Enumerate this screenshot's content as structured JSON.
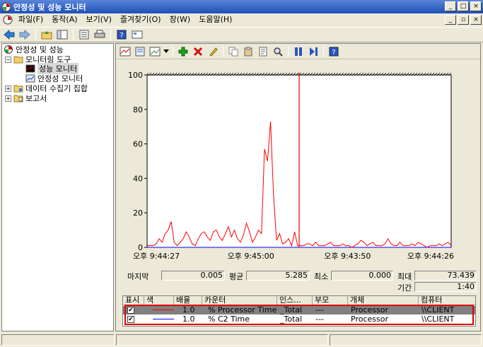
{
  "window": {
    "title": "안정성 및 성능 모니터",
    "btn_min": "_",
    "btn_max": "□",
    "btn_close": "×"
  },
  "menu": {
    "items": [
      "파일(F)",
      "동작(A)",
      "보기(V)",
      "즐겨찾기(O)",
      "창(W)",
      "도움말(H)"
    ],
    "child_min": "_",
    "child_restore": "▫",
    "child_close": "×"
  },
  "tree": {
    "root": "안정성 및 성능",
    "monitoring_tools": "모니터링 도구",
    "performance_monitor": "성능 모니터",
    "reliability_monitor": "안정성 모니터",
    "data_collector_sets": "데이터 수집기 집합",
    "reports": "보고서",
    "expand": "+",
    "collapse": "−"
  },
  "chart_data": {
    "type": "line",
    "ylim": [
      0,
      100
    ],
    "yticks": [
      0,
      20,
      40,
      60,
      80,
      100
    ],
    "xtick_labels": [
      "오후 9:44:27",
      "오후 9:45:00",
      "오후 9:43:50",
      "오후 9:44:26"
    ],
    "current_position": 0.5,
    "series": [
      {
        "name": "% Processor Time",
        "color": "#ff0000",
        "values": [
          1,
          1,
          1,
          2,
          5,
          3,
          8,
          10,
          15,
          3,
          1,
          3,
          5,
          9,
          6,
          2,
          1,
          5,
          8,
          9,
          6,
          4,
          9,
          10,
          6,
          4,
          8,
          12,
          6,
          10,
          5,
          3,
          7,
          14,
          9,
          3,
          6,
          10,
          8,
          57,
          50,
          73,
          30,
          4,
          8,
          2,
          3,
          5,
          1,
          9,
          1,
          1,
          1,
          2,
          2,
          1,
          3,
          1,
          1,
          1,
          2,
          3,
          1,
          1,
          1,
          2,
          1,
          1,
          0,
          1,
          2,
          4,
          3,
          1,
          2,
          3,
          1,
          1,
          1,
          2,
          5,
          2,
          1,
          1,
          3,
          1,
          1,
          1,
          2,
          1,
          3,
          2,
          1,
          0,
          1,
          1,
          1,
          2,
          1,
          2,
          3,
          1
        ]
      },
      {
        "name": "% C2 Time",
        "color": "#0000ff",
        "values": [
          0,
          0,
          0,
          0,
          0,
          0,
          0,
          0,
          0,
          0,
          0,
          0,
          0,
          0,
          0,
          0,
          0,
          0,
          0,
          0,
          0,
          0,
          0,
          0,
          0,
          0,
          0,
          0,
          0,
          0,
          0,
          0,
          0,
          0,
          0,
          0,
          0,
          0,
          0,
          0,
          0,
          0,
          0,
          0,
          0,
          0,
          0,
          0,
          0,
          0,
          0,
          0,
          0,
          0,
          0,
          0,
          0,
          0,
          0,
          0,
          0,
          0,
          0,
          0,
          0,
          0,
          0,
          0,
          0,
          0,
          0,
          0,
          0,
          0,
          0,
          0,
          0,
          0,
          0,
          0,
          0,
          0,
          0,
          0,
          0,
          0,
          0,
          0,
          0,
          0,
          0,
          0,
          0,
          0,
          0,
          0,
          0,
          0,
          0,
          0
        ]
      }
    ]
  },
  "stats": {
    "last_label": "마지막",
    "last": "0.005",
    "avg_label": "평균",
    "avg": "5.285",
    "min_label": "최소",
    "min": "0.000",
    "max_label": "최대",
    "max": "73.439",
    "duration_label": "기간",
    "duration": "1:40"
  },
  "counters": {
    "headers": [
      "표시",
      "색",
      "배율",
      "카운터",
      "인스...",
      "부모",
      "개체",
      "컴퓨터"
    ],
    "rows": [
      {
        "show": "✔",
        "color": "#ff0000",
        "scale": "1.0",
        "counter": "% Processor Time",
        "instance": "_Total",
        "parent": "---",
        "object": "Processor",
        "computer": "\\\\CLIENT"
      },
      {
        "show": "✔",
        "color": "#0000ff",
        "scale": "1.0",
        "counter": "% C2 Time",
        "instance": "_Total",
        "parent": "---",
        "object": "Processor",
        "computer": "\\\\CLIENT"
      }
    ]
  }
}
